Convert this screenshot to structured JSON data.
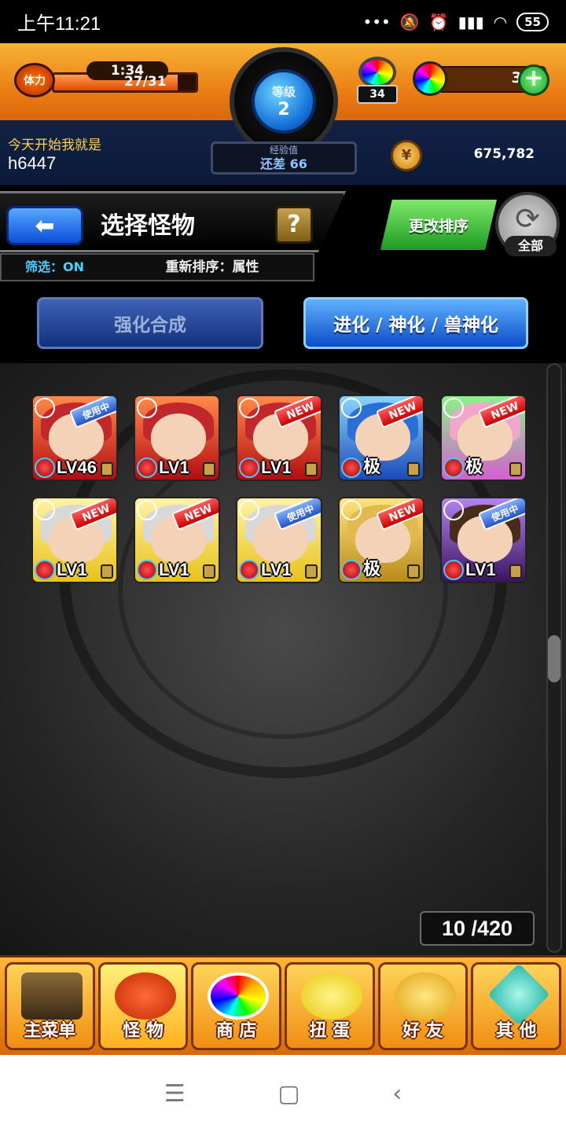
{
  "status_bar": {
    "time": "上午11:21",
    "battery": "55",
    "icons": [
      "dots-icon",
      "mute-icon",
      "alarm-icon",
      "signal-icon",
      "wifi-icon"
    ]
  },
  "hud": {
    "stamina_label": "体力",
    "stamina_timer": "1:34",
    "stamina_count": "27/31",
    "stamina_fraction": 0.87,
    "level_label": "等级",
    "level_value": "2",
    "exp_label": "经验值",
    "exp_value": "还差 66",
    "gem_count": "34",
    "orb_count": "31",
    "plus_label": "+",
    "player_tag": "今天开始我就是",
    "player_name": "h6447",
    "coins": "675,782"
  },
  "header": {
    "back_label": "⬅",
    "title": "选择怪物",
    "help_label": "?",
    "filter_status": "筛选：ON",
    "sort_label": "重新排序：属性",
    "reorder_label": "更改排序",
    "all_label": "全部"
  },
  "modes": {
    "power_up": "强化合成",
    "evolve": "进化 / 神化 / 兽神化"
  },
  "monsters": [
    {
      "element": "fire",
      "badge": "使用中",
      "badge_type": "use",
      "level": "LV46"
    },
    {
      "element": "fire",
      "badge": "",
      "badge_type": "",
      "level": "LV1"
    },
    {
      "element": "fire",
      "badge": "NEW",
      "badge_type": "new",
      "level": "LV1"
    },
    {
      "element": "water",
      "badge": "NEW",
      "badge_type": "new",
      "level": "极"
    },
    {
      "element": "wood",
      "badge": "NEW",
      "badge_type": "new",
      "level": "极"
    },
    {
      "element": "light",
      "badge": "NEW",
      "badge_type": "new",
      "level": "LV1"
    },
    {
      "element": "light",
      "badge": "NEW",
      "badge_type": "new",
      "level": "LV1"
    },
    {
      "element": "light",
      "badge": "使用中",
      "badge_type": "use",
      "level": "LV1"
    },
    {
      "element": "lightg",
      "badge": "NEW",
      "badge_type": "new",
      "level": "极"
    },
    {
      "element": "dark",
      "badge": "使用中",
      "badge_type": "use",
      "level": "LV1"
    }
  ],
  "box_count": "10 /420",
  "nav": [
    {
      "label": "主菜单",
      "icon": "menu",
      "name": "nav-main-menu"
    },
    {
      "label": "怪 物",
      "icon": "monster",
      "name": "nav-monster",
      "active": true
    },
    {
      "label": "商 店",
      "icon": "shop",
      "name": "nav-shop"
    },
    {
      "label": "扭 蛋",
      "icon": "gacha",
      "name": "nav-gacha"
    },
    {
      "label": "好 友",
      "icon": "friend",
      "name": "nav-friend"
    },
    {
      "label": "其 他",
      "icon": "other",
      "name": "nav-other"
    }
  ],
  "android_nav": {
    "menu": "☰",
    "home": "▢",
    "back": "‹"
  }
}
